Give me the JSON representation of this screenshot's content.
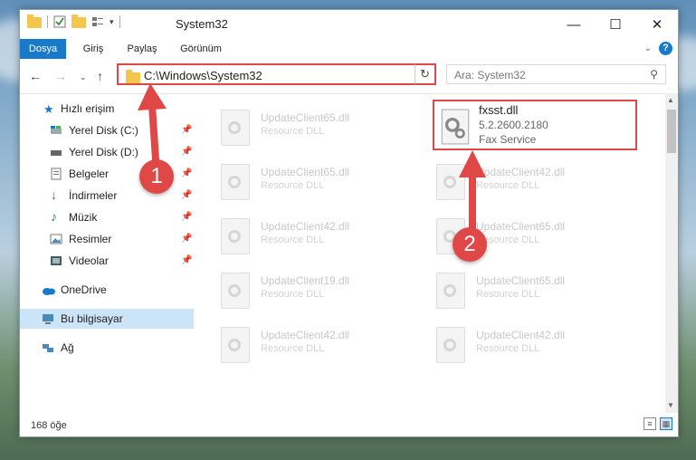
{
  "window": {
    "title": "System32"
  },
  "ribbon": {
    "tabs": [
      "Dosya",
      "Giriş",
      "Paylaş",
      "Görünüm"
    ]
  },
  "address": {
    "path": "C:\\Windows\\System32"
  },
  "search": {
    "placeholder": "Ara: System32"
  },
  "sidebar": {
    "quick_access": "Hızlı erişim",
    "items": [
      "Yerel Disk (C:)",
      "Yerel Disk (D:)",
      "Belgeler",
      "İndirmeler",
      "Müzik",
      "Resimler",
      "Videolar"
    ],
    "onedrive": "OneDrive",
    "this_pc": "Bu bilgisayar",
    "network": "Ağ"
  },
  "files": {
    "left": [
      {
        "name": "UpdateClient65.dll",
        "desc": "Resource DLL"
      },
      {
        "name": "UpdateClient65.dll",
        "desc": "Resource DLL"
      },
      {
        "name": "UpdateClient42.dll",
        "desc": "Resource DLL"
      },
      {
        "name": "UpdateClient19.dll",
        "desc": "Resource DLL"
      },
      {
        "name": "UpdateClient42.dll",
        "desc": "Resource DLL"
      }
    ],
    "right": [
      {
        "name": "UpdateClient42.dll",
        "desc": "Resource DLL"
      },
      {
        "name": "UpdateClient65.dll",
        "desc": "Resource DLL"
      },
      {
        "name": "UpdateClient65.dll",
        "desc": "Resource DLL"
      },
      {
        "name": "UpdateClient42.dll",
        "desc": "Resource DLL"
      }
    ],
    "target": {
      "name": "fxsst.dll",
      "version": "5.2.2600.2180",
      "desc": "Fax Service"
    }
  },
  "status": {
    "count": "168 öğe"
  },
  "annotations": {
    "badge1": "1",
    "badge2": "2",
    "color": "#e04848"
  }
}
